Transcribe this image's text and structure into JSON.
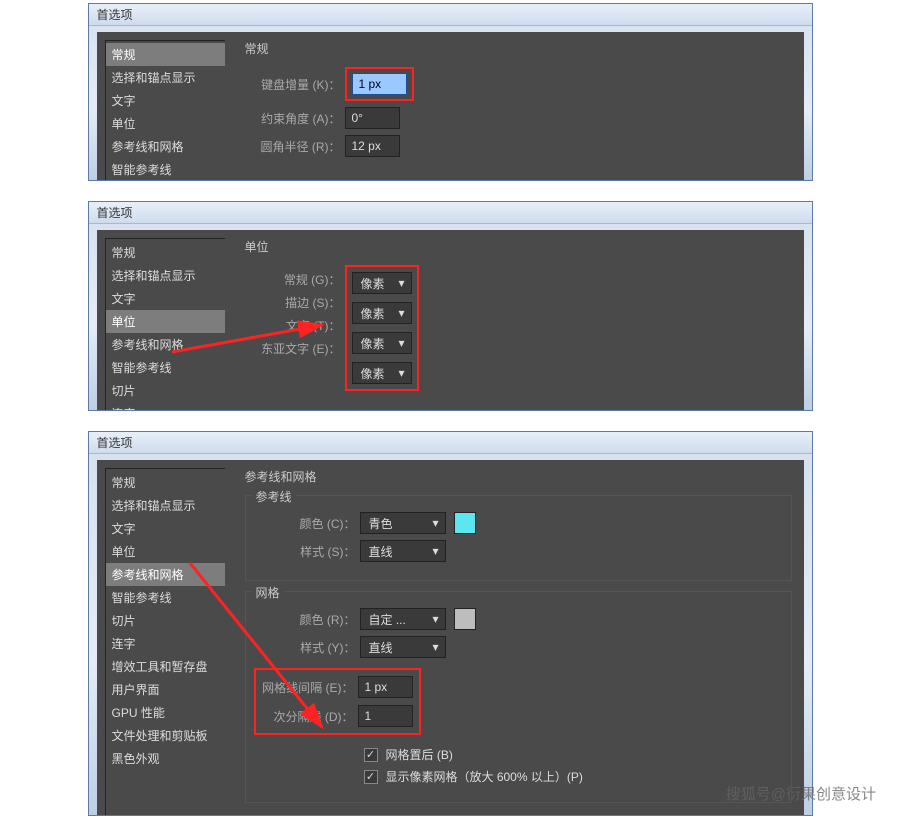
{
  "window_title": "首选项",
  "sidebar_full": [
    "常规",
    "选择和锚点显示",
    "文字",
    "单位",
    "参考线和网格",
    "智能参考线",
    "切片",
    "连字",
    "增效工具和暂存盘",
    "用户界面",
    "GPU 性能",
    "文件处理和剪贴板",
    "黑色外观"
  ],
  "panel1": {
    "selected": 0,
    "heading": "常规",
    "rows": {
      "keyboard_inc_label": "键盘增量 (K)：",
      "keyboard_inc_value": "1 px",
      "constrain_label": "约束角度 (A)：",
      "constrain_value": "0°",
      "corner_label": "圆角半径 (R)：",
      "corner_value": "12 px"
    }
  },
  "panel2": {
    "selected": 3,
    "heading": "单位",
    "rows": {
      "general_label": "常规 (G)：",
      "general_value": "像素",
      "stroke_label": "描边 (S)：",
      "stroke_value": "像素",
      "type_label": "文字 (T)：",
      "type_value": "像素",
      "asian_label": "东亚文字 (E)：",
      "asian_value": "像素"
    }
  },
  "panel3": {
    "selected": 4,
    "heading": "参考线和网格",
    "guides": {
      "legend": "参考线",
      "color_label": "颜色 (C)：",
      "color_value": "青色",
      "color_swatch": "#5ce6f0",
      "style_label": "样式 (S)：",
      "style_value": "直线"
    },
    "grid": {
      "legend": "网格",
      "color_label": "颜色 (R)：",
      "color_value": "自定 ...",
      "color_swatch": "#bdbdbd",
      "style_label": "样式 (Y)：",
      "style_value": "直线",
      "every_label": "网格线间隔 (E)：",
      "every_value": "1 px",
      "subdiv_label": "次分隔线 (D)：",
      "subdiv_value": "1",
      "cb1": "网格置后 (B)",
      "cb2": "显示像素网格（放大 600% 以上）(P)"
    }
  },
  "watermark": "搜狐号@衍果创意设计"
}
